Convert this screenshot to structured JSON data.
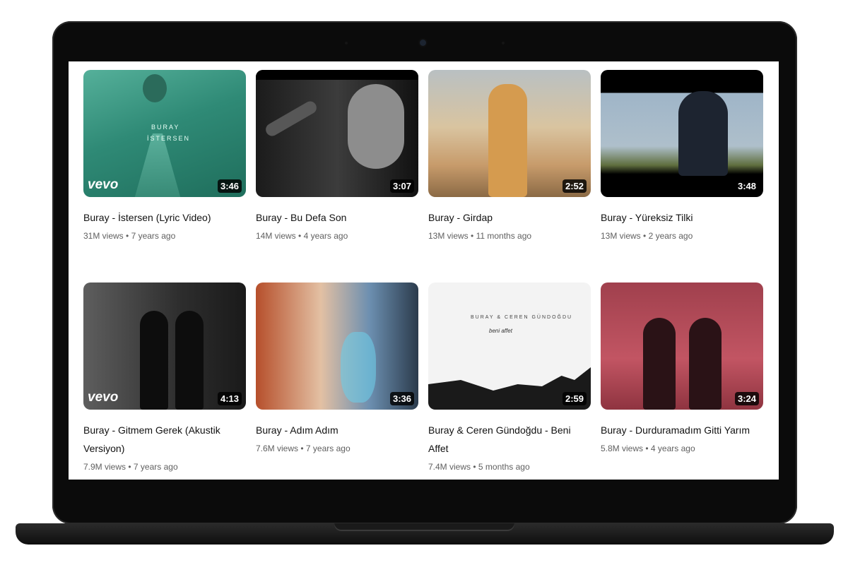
{
  "videos": [
    {
      "title": "Buray - İstersen (Lyric Video)",
      "views": "31M views",
      "age": "7 years ago",
      "duration": "3:46",
      "vevo": "vevo",
      "thumb_text_1": "BURAY",
      "thumb_text_2": "İSTERSEN"
    },
    {
      "title": "Buray - Bu Defa Son",
      "views": "14M views",
      "age": "4 years ago",
      "duration": "3:07"
    },
    {
      "title": "Buray - Girdap",
      "views": "13M views",
      "age": "11 months ago",
      "duration": "2:52"
    },
    {
      "title": "Buray - Yüreksiz Tilki",
      "views": "13M views",
      "age": "2 years ago",
      "duration": "3:48"
    },
    {
      "title": "Buray - Gitmem Gerek (Akustik Versiyon)",
      "views": "7.9M views",
      "age": "7 years ago",
      "duration": "4:13",
      "vevo": "vevo"
    },
    {
      "title": "Buray - Adım Adım",
      "views": "7.6M views",
      "age": "7 years ago",
      "duration": "3:36"
    },
    {
      "title": "Buray & Ceren Gündoğdu - Beni Affet",
      "views": "7.4M views",
      "age": "5 months ago",
      "duration": "2:59",
      "thumb_text_1": "BURAY & CEREN GÜNDOĞDU",
      "thumb_text_2": "beni affet"
    },
    {
      "title": "Buray - Durduramadım Gitti Yarım",
      "views": "5.8M views",
      "age": "4 years ago",
      "duration": "3:24"
    }
  ],
  "meta_separator": " • "
}
